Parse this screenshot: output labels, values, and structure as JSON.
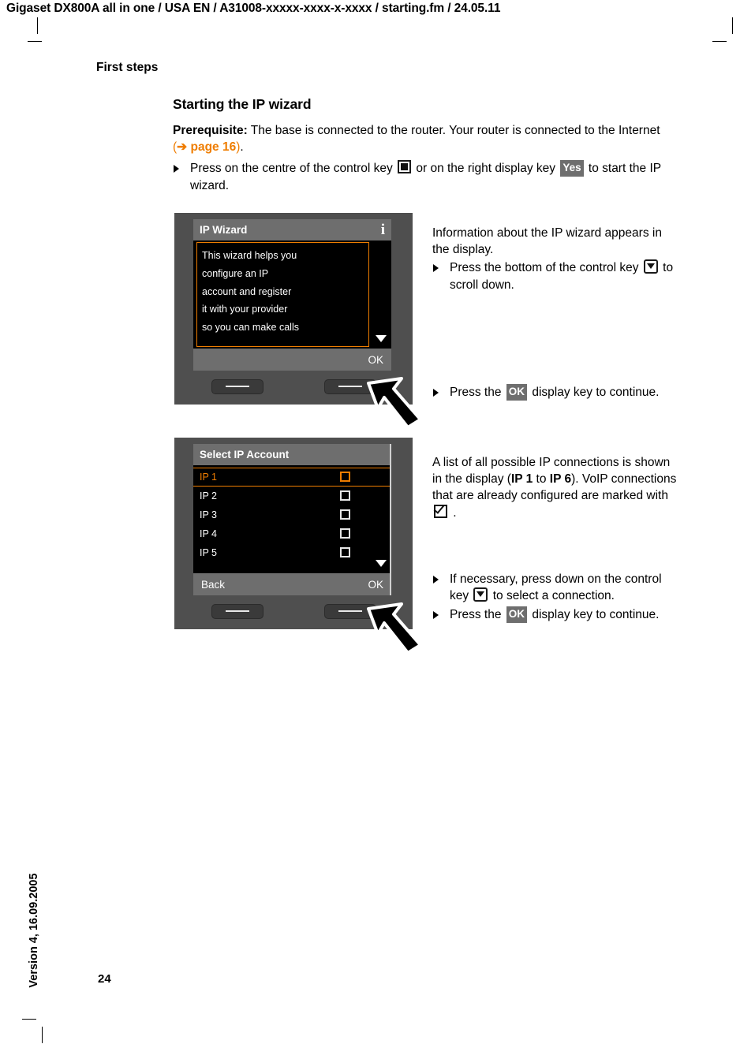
{
  "header": {
    "running_head": "Gigaset DX800A all in one / USA EN / A31008-xxxxx-xxxx-x-xxxx / starting.fm / 24.05.11"
  },
  "sidebar": {
    "version_text": "Version 4, 16.09.2005",
    "page_number": "24"
  },
  "chapter": {
    "title": "First steps"
  },
  "section": {
    "heading": "Starting the IP wizard",
    "prerequisite_label": "Prerequisite:",
    "prerequisite_text": " The base is connected to the router. Your router is connected to the Internet ",
    "crossref_open": "(",
    "crossref_arrow": "➔",
    "crossref_page": "page 16",
    "crossref_close": ")",
    "crossref_period": ".",
    "step1_part1": "Press on the centre of the control key ",
    "step1_part2": " or on the right display key ",
    "step1_key_yes": "Yes",
    "step1_part3": " to start the IP wizard."
  },
  "screen1": {
    "title": "IP Wizard",
    "info_icon": "i",
    "lines": [
      "This wizard helps you",
      "configure an IP",
      "account and register",
      "it with your provider",
      "so you can make calls"
    ],
    "softkey_left": "",
    "softkey_right": "OK"
  },
  "screen2": {
    "title": "Select IP Account",
    "rows": [
      {
        "label": "IP 1",
        "selected": true
      },
      {
        "label": "IP 2",
        "selected": false
      },
      {
        "label": "IP 3",
        "selected": false
      },
      {
        "label": "IP 4",
        "selected": false
      },
      {
        "label": "IP 5",
        "selected": false
      }
    ],
    "softkey_left": "Back",
    "softkey_right": "OK"
  },
  "annotation1": {
    "intro": "Information about the IP wizard appears in the display.",
    "bullet1_part1": "Press the bottom of the control key ",
    "bullet1_part2": " to scroll down.",
    "bullet2_part1": "Press the ",
    "bullet2_key": "OK",
    "bullet2_part2": " display key to continue."
  },
  "annotation2": {
    "intro_part1": "A list of all possible IP connections is shown in the display (",
    "intro_ip_first": "IP 1",
    "intro_mid": " to ",
    "intro_ip_last": "IP 6",
    "intro_part2": "). VoIP connections that are already configured are marked with ",
    "intro_part3": " .",
    "bullet1_part1": "If necessary, press down on the control key ",
    "bullet1_part2": " to select a connection.",
    "bullet2_part1": "Press the ",
    "bullet2_key": "OK",
    "bullet2_part2": " display key to continue."
  },
  "colors": {
    "accent_orange": "#ef7d00",
    "screen_frame": "#4f4f4f",
    "screen_bar": "#6e6e6e",
    "screen_bg": "#000000"
  }
}
